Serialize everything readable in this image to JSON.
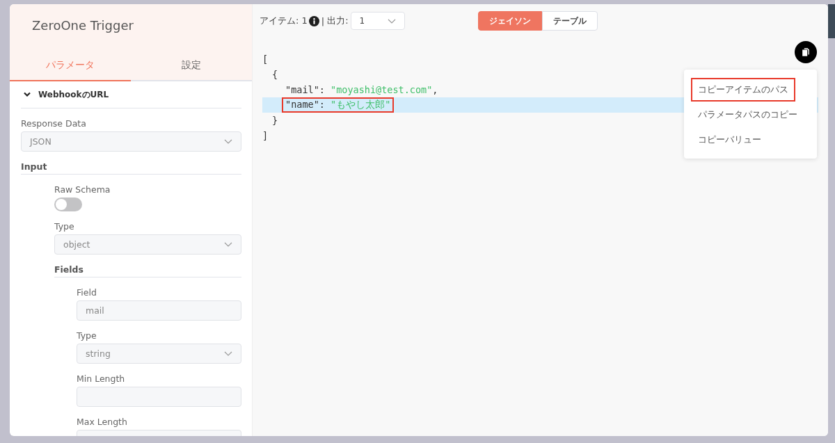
{
  "node": {
    "title": "ZeroOne Trigger",
    "tabs": [
      {
        "label": "パラメータ",
        "selected": true
      },
      {
        "label": "設定",
        "selected": false
      }
    ],
    "section": {
      "title": "WebhookのURL",
      "expanded": true
    },
    "params": [
      {
        "kind": "select",
        "label": "Response Data",
        "value": "JSON"
      },
      {
        "kind": "heading",
        "label": "Input",
        "children": [
          {
            "kind": "toggle",
            "label": "Raw Schema",
            "on": false
          },
          {
            "kind": "select",
            "label": "Type",
            "value": "object"
          },
          {
            "kind": "heading",
            "label": "Fields",
            "children": [
              {
                "kind": "text",
                "label": "Field",
                "value": "mail"
              },
              {
                "kind": "select",
                "label": "Type",
                "value": "string"
              },
              {
                "kind": "text",
                "label": "Min Length"
              },
              {
                "kind": "text",
                "label": "Max Length"
              }
            ]
          }
        ]
      }
    ]
  },
  "output": {
    "items_label": "アイテム: 1",
    "separator": "|",
    "output_label": "出力:",
    "output_value": "1",
    "views": [
      {
        "label": "ジェイソン",
        "selected": true
      },
      {
        "label": "テーブル",
        "selected": false
      }
    ],
    "json_lines": [
      {
        "kind": "bracket",
        "text": "["
      },
      {
        "kind": "bracket",
        "text": "{"
      },
      {
        "kind": "pair",
        "key": "\"mail\"",
        "colon": ":",
        "value": "\"moyashi@test.com\"",
        "comma": ",",
        "selected": false,
        "marked": false
      },
      {
        "kind": "pair",
        "key": "\"name\"",
        "colon": ":",
        "value": "\"もやし太郎\"",
        "selected": true,
        "marked": true
      },
      {
        "kind": "bracket",
        "text": "}"
      },
      {
        "kind": "bracket",
        "text": "]"
      }
    ],
    "copy_menu": [
      {
        "label": "コピーアイテムのパス",
        "marked": true
      },
      {
        "label": "パラメータパスのコピー",
        "marked": false
      },
      {
        "label": "コピーバリュー",
        "marked": false
      }
    ]
  }
}
